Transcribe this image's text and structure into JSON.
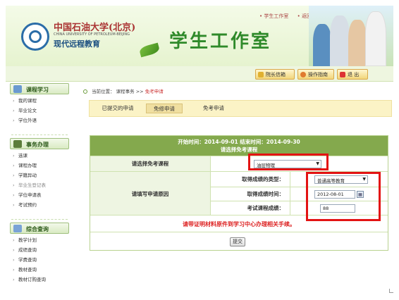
{
  "header": {
    "university_cn": "中国石油大学(北京)",
    "university_en": "CHINA UNIVERSITY OF PETROLEUM-BEIJING",
    "remote_edu": "现代远程教育",
    "title": "学生工作室",
    "top_links": [
      "• 学生工作室",
      "• 返回首页"
    ]
  },
  "toolbar": {
    "principal_mailbox": "院长信箱",
    "operation_guide": "操作指南",
    "logout": "退 出"
  },
  "sidebar": {
    "sections": [
      {
        "title": "课程学习",
        "items": [
          "我的课程",
          "毕业论文",
          "学位外语"
        ]
      },
      {
        "title": "事务办理",
        "items": [
          "选课",
          "课程办理",
          "学籍异动",
          "毕业生登记表",
          "学位申请表",
          "考试预约"
        ]
      },
      {
        "title": "综合查询",
        "items": [
          "教学计划",
          "成绩查询",
          "学费查询",
          "教材查询",
          "教材订购查询"
        ]
      }
    ]
  },
  "breadcrumb": {
    "prefix": "当前位置：",
    "path": "课程事务 >>",
    "current": "免考申请"
  },
  "tabs": [
    "已提交的申请",
    "免修申请",
    "免考申请"
  ],
  "form": {
    "period": "开始时间：2014-09-01 结束时间：2014-09-30",
    "subtitle": "请选择免考课程",
    "course_label": "请选择免考课程",
    "course_value": "油层物理",
    "reason_label": "请填写申请原因",
    "grade_type_label": "取得成绩的类型：",
    "grade_type_value": "普通高等教育",
    "grade_time_label": "取得成绩时间：",
    "grade_time_value": "2012-08-01",
    "exam_score_label": "考试课程成绩：",
    "exam_score_value": "88",
    "notice": "请带证明材料原件到学习中心办理相关手续。",
    "submit": "提交"
  },
  "colors": {
    "accent_green": "#84a94d",
    "highlight_red": "#e31313",
    "notice_red": "#dd2222"
  }
}
